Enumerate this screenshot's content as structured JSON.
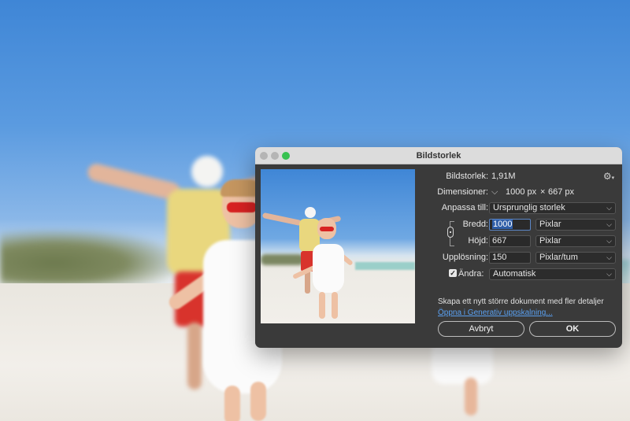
{
  "dialog": {
    "title": "Bildstorlek",
    "image_size": {
      "label": "Bildstorlek:",
      "value": "1,91M"
    },
    "dimensions": {
      "label": "Dimensioner:",
      "width": "1000 px",
      "times": "×",
      "height": "667 px"
    },
    "fit_to": {
      "label": "Anpassa till:",
      "value": "Ursprunglig storlek"
    },
    "width": {
      "label": "Bredd:",
      "value": "1000",
      "unit": "Pixlar"
    },
    "height": {
      "label": "Höjd:",
      "value": "667",
      "unit": "Pixlar"
    },
    "resolution": {
      "label": "Upplösning:",
      "value": "150",
      "unit": "Pixlar/tum"
    },
    "resample": {
      "label": "Ändra:",
      "checked": true,
      "check_glyph": "✓",
      "value": "Automatisk"
    },
    "hint_text": "Skapa ett nytt större dokument med fler detaljer",
    "generative_link": "Öppna i Generativ uppskalning...",
    "cancel_label": "Avbryt",
    "ok_label": "OK"
  },
  "icons": {
    "gear": "gear-icon",
    "chevron": "chevron-down-icon",
    "link": "chain-link-icon",
    "close": "close-icon",
    "minimize": "minimize-icon",
    "zoom": "zoom-icon"
  },
  "colors": {
    "dialog_bg": "#3a3a3a",
    "titlebar_bg": "#dcdcdc",
    "zoom_button": "#38c252",
    "link": "#5aa0f0",
    "field_selection": "#2f5ea8"
  }
}
